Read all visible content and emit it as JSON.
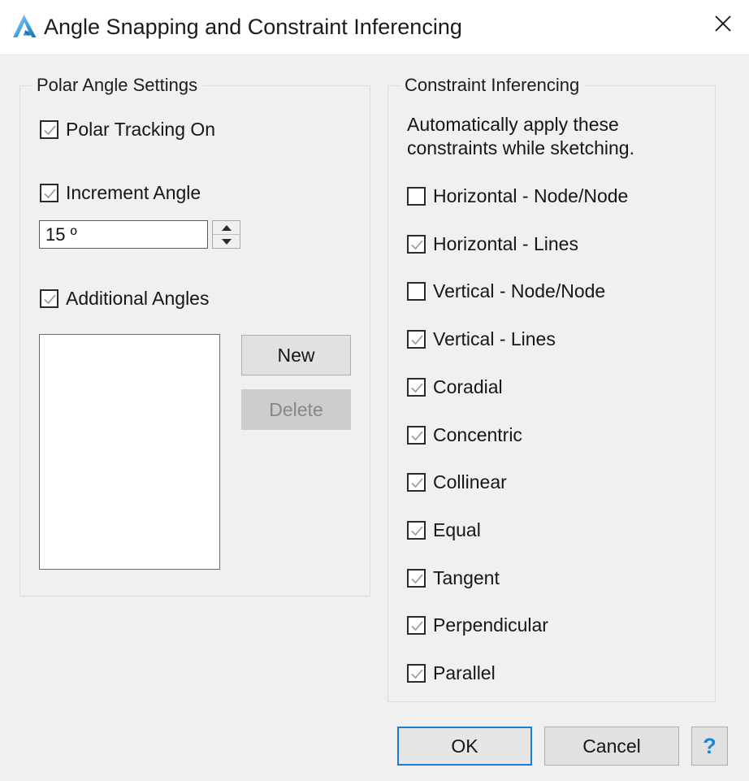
{
  "window": {
    "title": "Angle Snapping and Constraint Inferencing",
    "logo_icon": "autocad-a-logo-icon",
    "close_icon": "close-icon"
  },
  "polar_group": {
    "legend": "Polar Angle Settings",
    "polar_tracking": {
      "label": "Polar Tracking On",
      "checked": true
    },
    "increment_angle": {
      "label": "Increment Angle",
      "checked": true
    },
    "increment_value": "15 º",
    "spinner": {
      "up_icon": "triangle-up-icon",
      "down_icon": "triangle-down-icon"
    },
    "additional_angles": {
      "label": "Additional Angles",
      "checked": true
    },
    "angle_list_items": [],
    "new_button": "New",
    "delete_button": "Delete",
    "delete_disabled": true
  },
  "constraint_group": {
    "legend": "Constraint Inferencing",
    "hint": "Automatically apply these constraints while sketching.",
    "items": [
      {
        "label": "Horizontal - Node/Node",
        "checked": false
      },
      {
        "label": "Horizontal - Lines",
        "checked": true
      },
      {
        "label": "Vertical - Node/Node",
        "checked": false
      },
      {
        "label": "Vertical - Lines",
        "checked": true
      },
      {
        "label": "Coradial",
        "checked": true
      },
      {
        "label": "Concentric",
        "checked": true
      },
      {
        "label": "Collinear",
        "checked": true
      },
      {
        "label": "Equal",
        "checked": true
      },
      {
        "label": "Tangent",
        "checked": true
      },
      {
        "label": "Perpendicular",
        "checked": true
      },
      {
        "label": "Parallel",
        "checked": true
      }
    ]
  },
  "footer": {
    "ok": "OK",
    "cancel": "Cancel",
    "help": "?",
    "help_icon": "question-mark-icon"
  },
  "colors": {
    "dialog_background": "#f0f0f0",
    "titlebar_background": "#ffffff",
    "focus_accent": "#1a7fd4",
    "help_accent": "#1a8ad4",
    "checkmark": "#9a9a9a",
    "disabled_text": "#878787"
  }
}
